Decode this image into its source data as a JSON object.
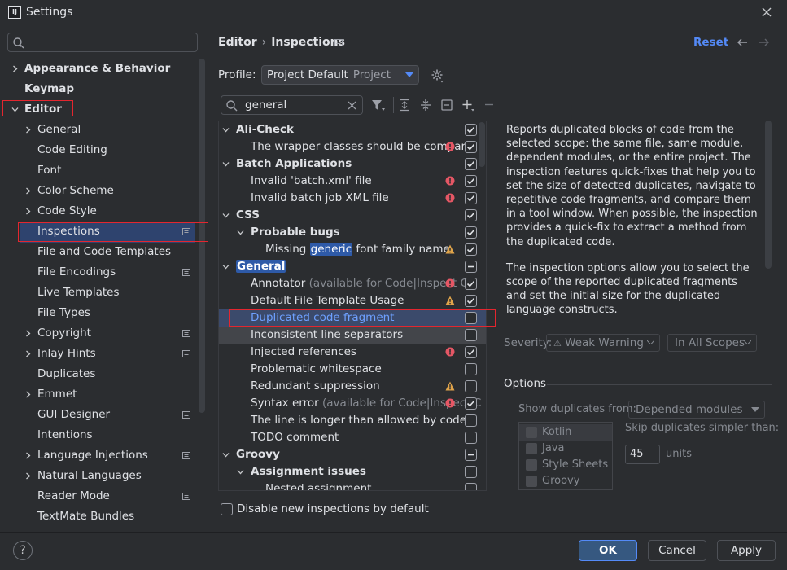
{
  "window": {
    "title": "Settings",
    "app_icon_text": "IJ"
  },
  "sidebar": {
    "search_placeholder": "",
    "items": [
      {
        "label": "Appearance & Behavior",
        "bold": true,
        "expand": "collapsed",
        "indent": 0
      },
      {
        "label": "Keymap",
        "bold": true,
        "expand": "none",
        "indent": 0
      },
      {
        "label": "Editor",
        "bold": true,
        "expand": "expanded",
        "indent": 0
      },
      {
        "label": "General",
        "expand": "collapsed",
        "indent": 1
      },
      {
        "label": "Code Editing",
        "expand": "none",
        "indent": 1
      },
      {
        "label": "Font",
        "expand": "none",
        "indent": 1
      },
      {
        "label": "Color Scheme",
        "expand": "collapsed",
        "indent": 1
      },
      {
        "label": "Code Style",
        "expand": "collapsed",
        "indent": 1
      },
      {
        "label": "Inspections",
        "expand": "none",
        "indent": 1,
        "selected": true,
        "page_icon": true
      },
      {
        "label": "File and Code Templates",
        "expand": "none",
        "indent": 1
      },
      {
        "label": "File Encodings",
        "expand": "none",
        "indent": 1,
        "page_icon": true
      },
      {
        "label": "Live Templates",
        "expand": "none",
        "indent": 1
      },
      {
        "label": "File Types",
        "expand": "none",
        "indent": 1
      },
      {
        "label": "Copyright",
        "expand": "collapsed",
        "indent": 1,
        "page_icon": true
      },
      {
        "label": "Inlay Hints",
        "expand": "collapsed",
        "indent": 1,
        "page_icon": true
      },
      {
        "label": "Duplicates",
        "expand": "none",
        "indent": 1
      },
      {
        "label": "Emmet",
        "expand": "collapsed",
        "indent": 1
      },
      {
        "label": "GUI Designer",
        "expand": "none",
        "indent": 1,
        "page_icon": true
      },
      {
        "label": "Intentions",
        "expand": "none",
        "indent": 1
      },
      {
        "label": "Language Injections",
        "expand": "collapsed",
        "indent": 1,
        "page_icon": true
      },
      {
        "label": "Natural Languages",
        "expand": "collapsed",
        "indent": 1
      },
      {
        "label": "Reader Mode",
        "expand": "none",
        "indent": 1,
        "page_icon": true
      },
      {
        "label": "TextMate Bundles",
        "expand": "none",
        "indent": 1
      }
    ]
  },
  "header": {
    "breadcrumb": [
      "Editor",
      "Inspections"
    ],
    "reset_label": "Reset"
  },
  "profile": {
    "label": "Profile:",
    "value": "Project Default",
    "sub": "Project"
  },
  "filter": {
    "value": "general"
  },
  "inspections": [
    {
      "label": "Ali-Check",
      "bold": true,
      "level": 0,
      "arrow": "expanded",
      "check": "checked"
    },
    {
      "label": "The wrapper classes should be compare",
      "level": 1,
      "warn": "error",
      "check": "checked"
    },
    {
      "label": "Batch Applications",
      "bold": true,
      "level": 0,
      "arrow": "expanded",
      "check": "checked"
    },
    {
      "label": "Invalid 'batch.xml' file",
      "level": 1,
      "warn": "error",
      "check": "checked"
    },
    {
      "label": "Invalid batch job XML file",
      "level": 1,
      "warn": "error",
      "check": "checked"
    },
    {
      "label": "CSS",
      "bold": true,
      "level": 0,
      "arrow": "expanded",
      "check": "checked"
    },
    {
      "label": "Probable bugs",
      "bold": true,
      "level": 1,
      "arrow": "expanded",
      "check": "checked"
    },
    {
      "label_pre": "Missing ",
      "label_hl": "generic",
      "label_post": " font family name",
      "level": 2,
      "warn": "warning",
      "check": "checked"
    },
    {
      "label": "General",
      "bold": true,
      "level": 0,
      "arrow": "expanded",
      "check": "partial",
      "highlight": true
    },
    {
      "label": "Annotator",
      "extra": " (available for Code|Inspect Co",
      "level": 1,
      "warn": "error",
      "check": "checked"
    },
    {
      "label": "Default File Template Usage",
      "level": 1,
      "warn": "warning",
      "check": "checked"
    },
    {
      "label": "Duplicated code fragment",
      "level": 1,
      "check": "unchecked",
      "selected": true
    },
    {
      "label": "Inconsistent line separators",
      "level": 1,
      "check": "unchecked"
    },
    {
      "label": "Injected references",
      "level": 1,
      "warn": "error",
      "check": "checked"
    },
    {
      "label": "Problematic whitespace",
      "level": 1,
      "check": "unchecked"
    },
    {
      "label": "Redundant suppression",
      "level": 1,
      "warn": "warning",
      "check": "unchecked"
    },
    {
      "label": "Syntax error",
      "extra": " (available for Code|Inspect C",
      "level": 1,
      "warn": "error",
      "check": "checked"
    },
    {
      "label": "The line is longer than allowed by code s",
      "level": 1,
      "check": "unchecked"
    },
    {
      "label": "TODO comment",
      "level": 1,
      "check": "unchecked"
    },
    {
      "label": "Groovy",
      "bold": true,
      "level": 0,
      "arrow": "expanded",
      "check": "partial"
    },
    {
      "label": "Assignment issues",
      "bold": true,
      "level": 1,
      "arrow": "expanded",
      "check": "unchecked"
    },
    {
      "label": "Nested assignment",
      "level": 2,
      "check": "unchecked"
    }
  ],
  "disable_new": {
    "label": "Disable new inspections by default",
    "checked": false
  },
  "description": {
    "p1": "Reports duplicated blocks of code from the selected scope: the same file, same module, dependent modules, or the entire project. The inspection features quick-fixes that help you to set the size of detected duplicates, navigate to repetitive code fragments, and compare them in a tool window. When possible, the inspection provides a quick-fix to extract a method from the duplicated code.",
    "p2": "The inspection options allow you to select the scope of the reported duplicated fragments and set the initial size for the duplicated language constructs."
  },
  "severity": {
    "label": "Severity:",
    "value": "Weak Warning",
    "scope": "In All Scopes"
  },
  "options": {
    "title": "Options",
    "show_dup_label": "Show duplicates from:",
    "show_dup_value": "Depended modules",
    "languages": [
      "Kotlin",
      "Java",
      "Style Sheets",
      "Groovy"
    ],
    "skip_label": "Skip duplicates simpler than:",
    "skip_value": "45",
    "units_label": "units"
  },
  "footer": {
    "help": "?",
    "ok": "OK",
    "cancel": "Cancel",
    "apply": "Apply"
  },
  "colors": {
    "accent": "#548af7",
    "background": "#2b2d30",
    "error": "#e55765",
    "warning": "#e0a44a",
    "highlight_box": "#e3262f"
  }
}
